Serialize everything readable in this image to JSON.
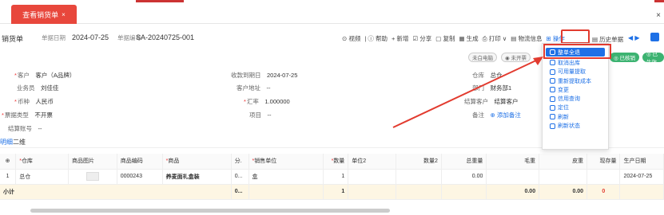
{
  "tabs": {
    "active_label": "查看销货单",
    "close": "×"
  },
  "window": {
    "close": "×"
  },
  "header": {
    "doc_type": "销货单",
    "date_label": "单据日期",
    "date": "2024-07-25",
    "no_label": "单据编号",
    "no": "SA-20240725-001"
  },
  "toolbar": {
    "items": [
      "⊙ 视频",
      "| ⓘ 帮助",
      "+ 新增",
      "☑ 分享",
      "▢ 复制",
      "▦ 生成",
      "⎙ 打印 ∨",
      "▤ 物流信息"
    ],
    "op": "⊞ 操作",
    "hist": "▤ 历史单据",
    "prev": "◀",
    "next": "▶"
  },
  "status": {
    "s1": "未白电脑",
    "s2": "◉ 未开票",
    "s3": "◎ 已核销",
    "s4": "◎ 已生效"
  },
  "form": {
    "customer_label": "客户",
    "customer": "客户（A品牌）",
    "sales_label": "业务员",
    "sales": "刘佳佳",
    "currency_label": "币种",
    "currency": "人民币",
    "invoice_label": "票据类型",
    "invoice": "不开票",
    "account_label": "结算账号",
    "account": "--",
    "due_label": "收款到期日",
    "due": "2024-07-25",
    "addr_label": "客户地址",
    "addr": "--",
    "rate_label": "汇率",
    "rate": "1.000000",
    "project_label": "项目",
    "project": "--",
    "warehouse_label": "仓库",
    "warehouse": "总仓",
    "dept_label": "部门",
    "dept": "财务部1",
    "settle_label": "结算客户",
    "settle": "结算客户",
    "remark_label": "备注",
    "remark": "⊕ 添加备注"
  },
  "section_tabs": {
    "detail": "明细",
    "dim": "二维"
  },
  "table": {
    "headers": [
      "⊕",
      "仓库",
      "商品图片",
      "商品编码",
      "商品",
      "分.",
      "销售单位",
      "数量",
      "单位2",
      "数量2",
      "总重量",
      "毛重",
      "皮重",
      "现存量",
      "生产日期"
    ],
    "row": {
      "idx": "1",
      "wh": "总仓",
      "code": "0000243",
      "name": "养麦面礼盒装",
      "cat": "0...",
      "unit": "盒",
      "qty": "1",
      "weight": "0.00",
      "prod": "2024-07-25"
    },
    "sum": {
      "label": "小计",
      "cat": "0...",
      "qty": "1",
      "gross": "0.00",
      "tare": "0.00",
      "stock": "0"
    }
  },
  "dropdown": {
    "items": [
      "整单全退",
      "取消出库",
      "可用量提取",
      "重新提取成本",
      "变更",
      "信用查询",
      "定位",
      "刷新",
      "刷新状态"
    ]
  },
  "colors": {
    "accent": "#1e70e6",
    "brand_red": "#e8473c",
    "annot_red": "#e23b2f"
  }
}
